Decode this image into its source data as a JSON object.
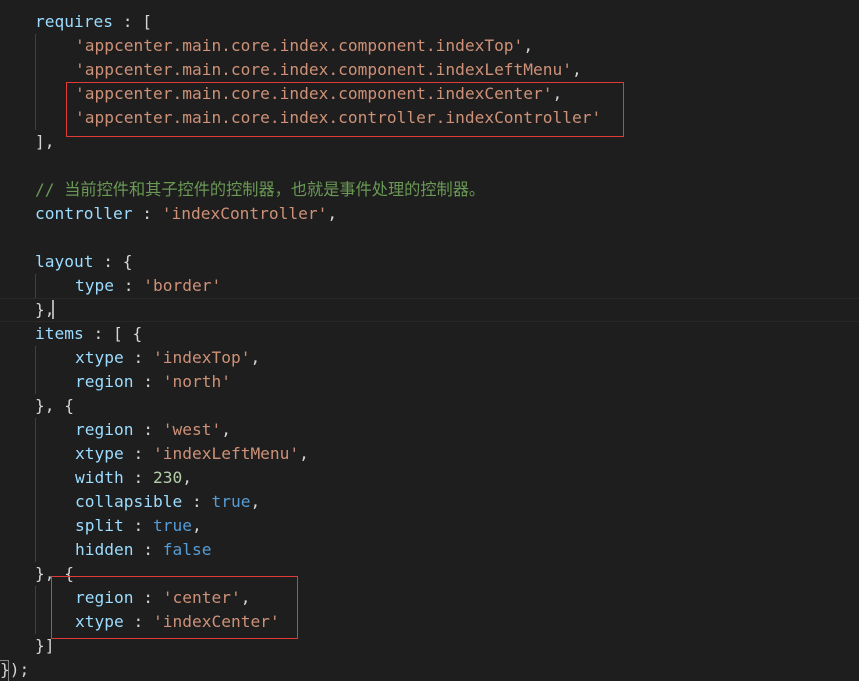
{
  "code_lines": [
    "requires : [",
    "    'appcenter.main.core.index.component.indexTop',",
    "    'appcenter.main.core.index.component.indexLeftMenu',",
    "    'appcenter.main.core.index.component.indexCenter',",
    "    'appcenter.main.core.index.controller.indexController'",
    "],",
    "",
    "// 当前控件和其子控件的控制器，也就是事件处理的控制器。",
    "controller : 'indexController',",
    "",
    "layout : {",
    "    type : 'border'",
    "},",
    "items : [ {",
    "    xtype : 'indexTop',",
    "    region : 'north'",
    "}, {",
    "    region : 'west',",
    "    xtype : 'indexLeftMenu',",
    "    width : 230,",
    "    collapsible : true,",
    "    split : true,",
    "    hidden : false",
    "}, {",
    "    region : 'center',",
    "    xtype : 'indexCenter'",
    "}]",
    "});"
  ],
  "highlight_color": "#e03a3a",
  "colors": {
    "background": "#1e1e1e",
    "property": "#9cdcfe",
    "string": "#ce9178",
    "number": "#b5cea8",
    "boolean": "#569cd6",
    "comment": "#6a9955",
    "punctuation": "#d4d4d4"
  }
}
